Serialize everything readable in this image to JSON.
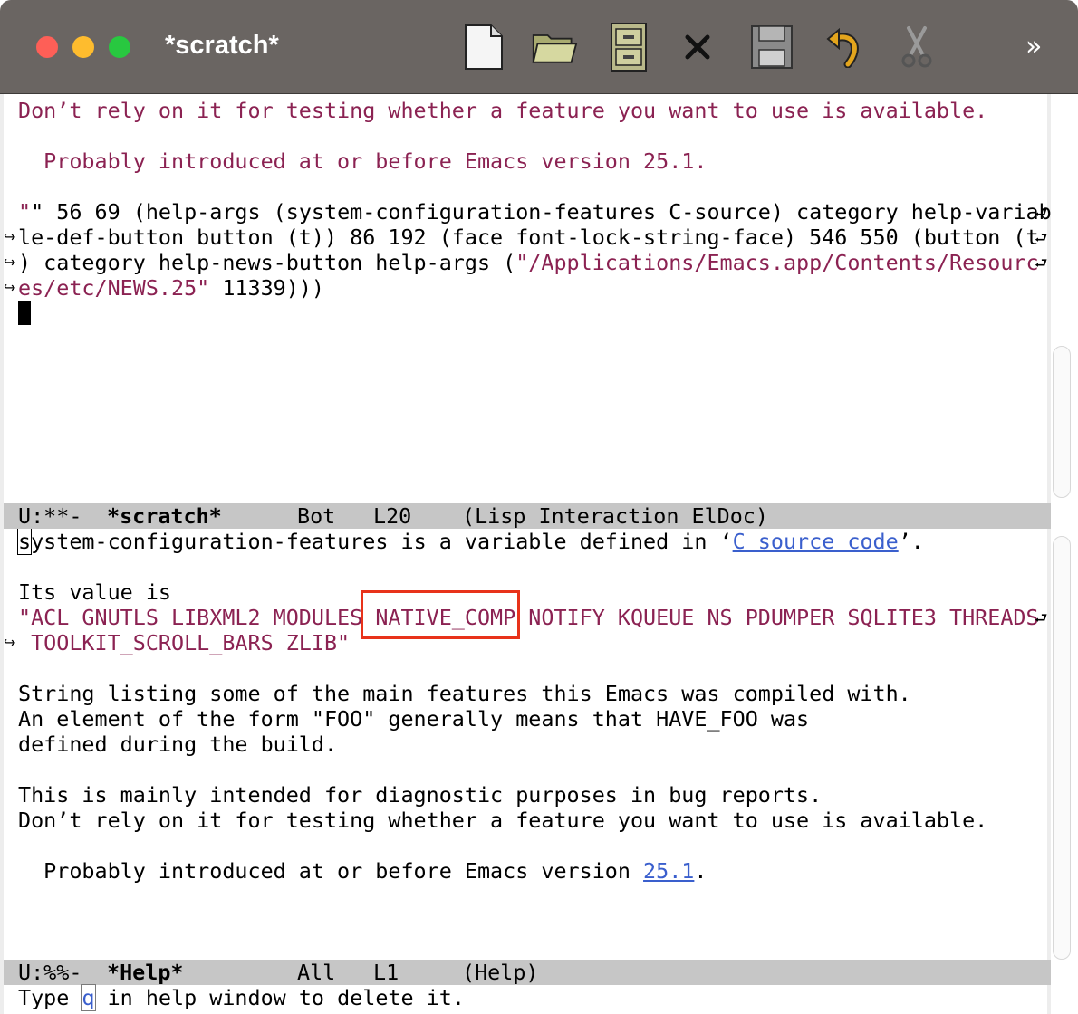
{
  "window": {
    "title": "*scratch*",
    "toolbar": [
      {
        "name": "new-file-icon",
        "color": "#f4f4f4"
      },
      {
        "name": "open-folder-icon",
        "color": "#c7c98f"
      },
      {
        "name": "dired-cabinet-icon",
        "color": "#b9b98a"
      },
      {
        "name": "close-buffer-icon",
        "color": "#111111"
      },
      {
        "name": "save-icon",
        "color": "#8a8a8a"
      },
      {
        "name": "undo-icon",
        "color": "#e3a51d"
      },
      {
        "name": "cut-icon",
        "color": "#9a9a9a"
      }
    ],
    "more_label": "»"
  },
  "scratch": {
    "line1": "Don’t rely on it for testing whether a feature you want to use is available.",
    "line2": "  Probably introduced at or before Emacs version 25.1.",
    "line3": "\" 56 69 (help-args (system-configuration-features C-source) category help-variab",
    "line4": "le-def-button button (t)) 86 192 (face font-lock-string-face) 546 550 (button (t",
    "line5a": ") category help-news-button help-args (",
    "line5b": "\"/Applications/Emacs.app/Contents/Resourc",
    "line6a": "es/etc/NEWS.25\"",
    "line6b": " 11339)))"
  },
  "modeline_scratch": {
    "state": "U:**-",
    "buffer": "*scratch*",
    "position": "Bot",
    "line": "L20",
    "mode": "(Lisp Interaction ElDoc)"
  },
  "help": {
    "l1_cursor_char": "s",
    "l1_rest": "ystem-configuration-features is a variable defined in ‘",
    "l1_link": "C source code",
    "l1_end": "’.",
    "l2": "Its value is",
    "l3a": "\"ACL GNUTLS LIBXML2 MODULES ",
    "l3b": "NATIVE_COMP",
    "l3c": " NOTIFY KQUEUE NS PDUMPER SQLITE3 THREADS",
    "l4": " TOOLKIT_SCROLL_BARS ZLIB\"",
    "l5": "String listing some of the main features this Emacs was compiled with.",
    "l6": "An element of the form \"FOO\" generally means that HAVE_FOO was",
    "l7": "defined during the build.",
    "l8": "This is mainly intended for diagnostic purposes in bug reports.",
    "l9": "Don’t rely on it for testing whether a feature you want to use is available.",
    "l10a": "  Probably introduced at or before Emacs version ",
    "l10_link": "25.1",
    "l10_end": "."
  },
  "modeline_help": {
    "state": "U:%%-",
    "buffer": "*Help*",
    "position": "All",
    "line": "L1",
    "mode": "(Help)"
  },
  "echo": {
    "before": "Type ",
    "key": "q",
    "after": " in help window to delete it."
  },
  "colors": {
    "string": "#8b2252",
    "link": "#3a5fcd",
    "modeline_bg": "#c6c6c6",
    "highlight_border": "#e8321a"
  }
}
